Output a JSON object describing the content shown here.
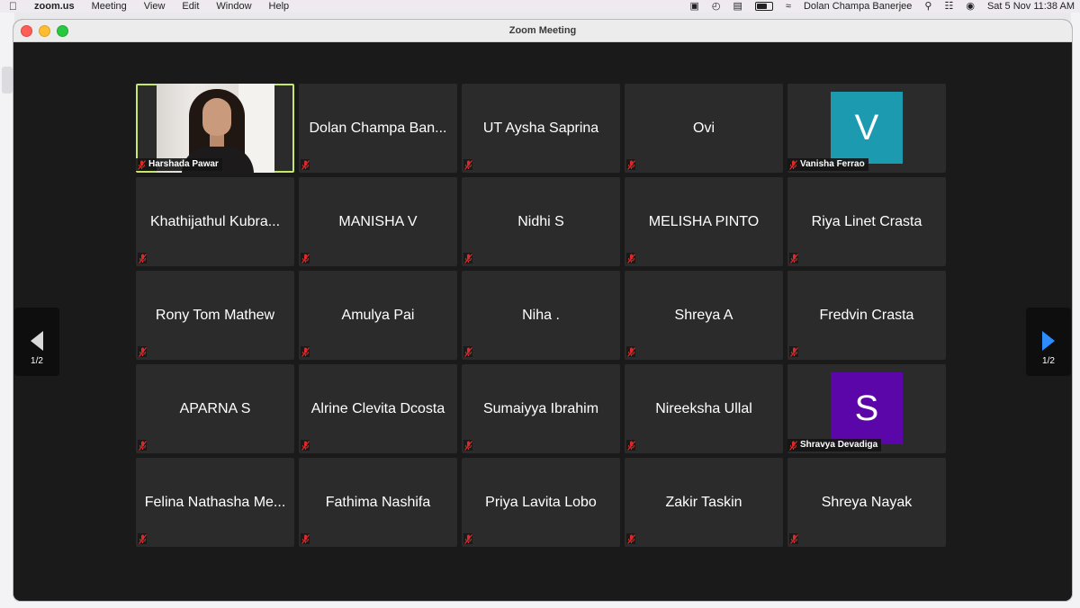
{
  "menubar": {
    "app": "zoom.us",
    "items": [
      "Meeting",
      "View",
      "Edit",
      "Window",
      "Help"
    ],
    "user": "Dolan Champa Banerjee",
    "datetime": "Sat 5 Nov  11:38 AM"
  },
  "window": {
    "title": "Zoom Meeting"
  },
  "pagination": {
    "prev_label": "1/2",
    "next_label": "1/2",
    "next_arrow_color": "#2d8cff"
  },
  "active_speaker_color": "#c5e86c",
  "participants": [
    {
      "name": "Harshada Pawar",
      "type": "video",
      "label": "Harshada Pawar"
    },
    {
      "name": "Dolan Champa Ban...",
      "type": "name"
    },
    {
      "name": "UT Aysha Saprina",
      "type": "name"
    },
    {
      "name": "Ovi",
      "type": "name"
    },
    {
      "name": "Vanisha Ferrao",
      "type": "avatar",
      "initial": "V",
      "color": "#1c9bb0",
      "label": "Vanisha Ferrao"
    },
    {
      "name": "Khathijathul Kubra...",
      "type": "name"
    },
    {
      "name": "MANISHA V",
      "type": "name"
    },
    {
      "name": "Nidhi S",
      "type": "name"
    },
    {
      "name": "MELISHA PINTO",
      "type": "name"
    },
    {
      "name": "Riya Linet Crasta",
      "type": "name"
    },
    {
      "name": "Rony Tom Mathew",
      "type": "name"
    },
    {
      "name": "Amulya Pai",
      "type": "name"
    },
    {
      "name": "Niha .",
      "type": "name"
    },
    {
      "name": "Shreya A",
      "type": "name"
    },
    {
      "name": "Fredvin Crasta",
      "type": "name"
    },
    {
      "name": "APARNA S",
      "type": "name"
    },
    {
      "name": "Alrine Clevita Dcosta",
      "type": "name"
    },
    {
      "name": "Sumaiyya Ibrahim",
      "type": "name"
    },
    {
      "name": "Nireeksha Ullal",
      "type": "name"
    },
    {
      "name": "Shravya Devadiga",
      "type": "avatar",
      "initial": "S",
      "color": "#5a06a8",
      "label": "Shravya Devadiga"
    },
    {
      "name": "Felina Nathasha Me...",
      "type": "name"
    },
    {
      "name": "Fathima Nashifa",
      "type": "name"
    },
    {
      "name": "Priya Lavita Lobo",
      "type": "name"
    },
    {
      "name": "Zakir Taskin",
      "type": "name"
    },
    {
      "name": "Shreya Nayak",
      "type": "name"
    }
  ]
}
